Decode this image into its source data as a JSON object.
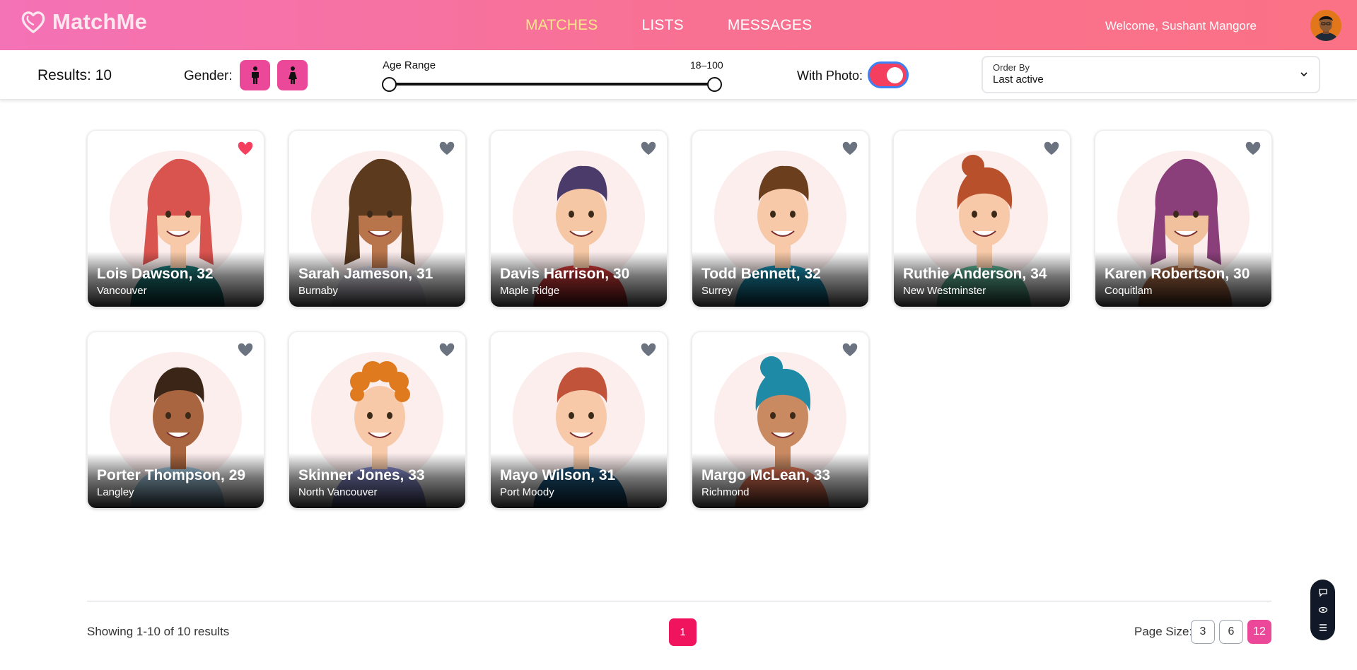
{
  "brand": {
    "name": "MatchMe"
  },
  "nav": {
    "items": [
      {
        "label": "MATCHES",
        "active": true
      },
      {
        "label": "LISTS",
        "active": false
      },
      {
        "label": "MESSAGES",
        "active": false
      }
    ]
  },
  "user": {
    "welcome": "Welcome, Sushant Mangore"
  },
  "filters": {
    "results": "Results: 10",
    "gender_label": "Gender:",
    "age_label": "Age Range",
    "age_value": "18–100",
    "age_min": 18,
    "age_max": 100,
    "photo_label": "With Photo:",
    "photo_on": true,
    "order_label": "Order By",
    "order_value": "Last active"
  },
  "members": [
    {
      "name": "Lois Dawson,",
      "age": "32",
      "city": "Vancouver",
      "liked": true,
      "hair": "#d9534f",
      "skin": "#f7c9a8",
      "shirt": "#1e7b7b",
      "style": "long"
    },
    {
      "name": "Sarah Jameson,",
      "age": "31",
      "city": "Burnaby",
      "liked": false,
      "hair": "#5b3a1e",
      "skin": "#b8754c",
      "shirt": "#e8e4f0",
      "style": "long"
    },
    {
      "name": "Davis Harrison,",
      "age": "30",
      "city": "Maple Ridge",
      "liked": false,
      "hair": "#4b3b6b",
      "skin": "#f5c7a4",
      "shirt": "#d93b3b",
      "style": "short"
    },
    {
      "name": "Todd Bennett,",
      "age": "32",
      "city": "Surrey",
      "liked": false,
      "hair": "#6b3e1e",
      "skin": "#f7c9a8",
      "shirt": "#1a94b8",
      "style": "short"
    },
    {
      "name": "Ruthie Anderson,",
      "age": "34",
      "city": "New Westminster",
      "liked": false,
      "hair": "#b8502c",
      "skin": "#f7c9a8",
      "shirt": "#5fb89a",
      "style": "bun"
    },
    {
      "name": "Karen Robertson,",
      "age": "30",
      "city": "Coquitlam",
      "liked": false,
      "hair": "#8a3f7a",
      "skin": "#f0c19c",
      "shirt": "#b5714a",
      "style": "long"
    },
    {
      "name": "Porter Thompson,",
      "age": "29",
      "city": "Langley",
      "liked": false,
      "hair": "#3a2517",
      "skin": "#a8653f",
      "shirt": "#a9d0e8",
      "style": "short"
    },
    {
      "name": "Skinner Jones,",
      "age": "33",
      "city": "North Vancouver",
      "liked": false,
      "hair": "#e07a1e",
      "skin": "#f7c9a8",
      "shirt": "#8c92d4",
      "style": "curly"
    },
    {
      "name": "Mayo Wilson,",
      "age": "31",
      "city": "Port Moody",
      "liked": false,
      "hair": "#c0533a",
      "skin": "#f7c9a8",
      "shirt": "#1e5f8a",
      "style": "short"
    },
    {
      "name": "Margo McLean,",
      "age": "33",
      "city": "Richmond",
      "liked": false,
      "hair": "#1f8aa5",
      "skin": "#c98a62",
      "shirt": "#ef7a5a",
      "style": "bun"
    }
  ],
  "footer": {
    "showing": "Showing 1-10 of 10 results",
    "current_page": "1",
    "page_size_label": "Page Size:",
    "page_sizes": [
      "3",
      "6",
      "12"
    ],
    "active_page_size": "12"
  },
  "colors": {
    "accent": "#ec4899",
    "liked": "#f43f5e",
    "unliked": "#6b7280"
  }
}
